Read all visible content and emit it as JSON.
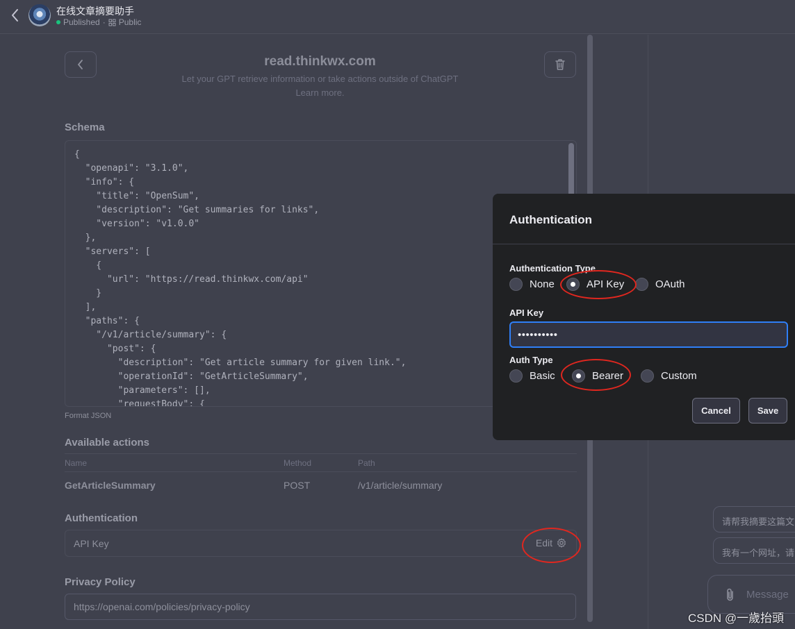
{
  "header": {
    "title": "在线文章摘要助手",
    "status": "Published",
    "separator": "·",
    "visibility": "Public"
  },
  "action_editor": {
    "domain": "read.thinkwx.com",
    "description": "Let your GPT retrieve information or take actions outside of ChatGPT",
    "learn_more": "Learn more.",
    "schema_label": "Schema",
    "schema_text": "{\n  \"openapi\": \"3.1.0\",\n  \"info\": {\n    \"title\": \"OpenSum\",\n    \"description\": \"Get summaries for links\",\n    \"version\": \"v1.0.0\"\n  },\n  \"servers\": [\n    {\n      \"url\": \"https://read.thinkwx.com/api\"\n    }\n  ],\n  \"paths\": {\n    \"/v1/article/summary\": {\n      \"post\": {\n        \"description\": \"Get article summary for given link.\",\n        \"operationId\": \"GetArticleSummary\",\n        \"parameters\": [],\n        \"requestBody\": {",
    "format_json": "Format JSON",
    "available_actions_label": "Available actions",
    "columns": [
      "Name",
      "Method",
      "Path"
    ],
    "actions": [
      {
        "name": "GetArticleSummary",
        "method": "POST",
        "path": "/v1/article/summary"
      }
    ],
    "authentication_label": "Authentication",
    "authentication_value": "API Key",
    "edit_label": "Edit",
    "privacy_label": "Privacy Policy",
    "privacy_url": "https://openai.com/policies/privacy-policy"
  },
  "preview": {
    "suggestions": [
      "请帮我摘要这篇文",
      "我有一个网址，请"
    ],
    "composer_placeholder": "Message"
  },
  "watermark": "CSDN @一歲抬頭",
  "auth_modal": {
    "title": "Authentication",
    "auth_type_label": "Authentication Type",
    "auth_types": [
      "None",
      "API Key",
      "OAuth"
    ],
    "auth_type_selected": "API Key",
    "api_key_label": "API Key",
    "api_key_value": "••••••••••",
    "sub_type_label": "Auth Type",
    "sub_types": [
      "Basic",
      "Bearer",
      "Custom"
    ],
    "sub_type_selected": "Bearer",
    "cancel_label": "Cancel",
    "save_label": "Save"
  },
  "colors": {
    "background": "#3f414d",
    "modal_background": "#202123",
    "focus_border": "#2f7ff7",
    "annotation_red": "#e0271f",
    "published_dot": "#19c37d"
  }
}
